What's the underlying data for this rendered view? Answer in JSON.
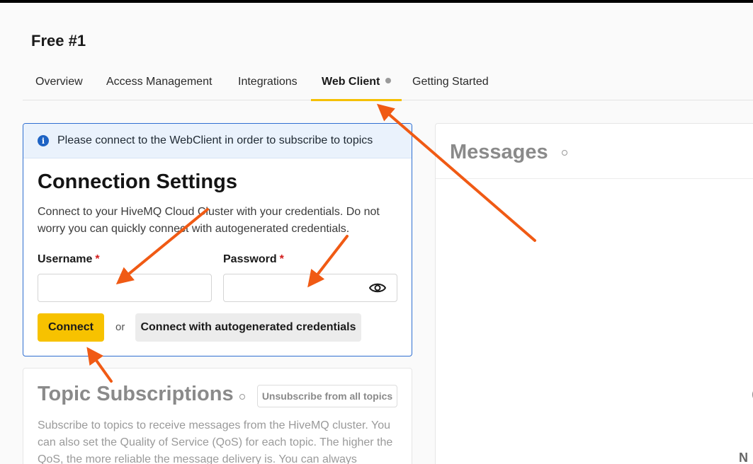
{
  "page": {
    "title": "Free #1"
  },
  "tabs": [
    {
      "label": "Overview"
    },
    {
      "label": "Access Management"
    },
    {
      "label": "Integrations"
    },
    {
      "label": "Web Client",
      "active": true
    },
    {
      "label": "Getting Started"
    }
  ],
  "connection": {
    "info_text": "Please connect to the WebClient in order to subscribe to topics",
    "title": "Connection Settings",
    "description": "Connect to your HiveMQ Cloud Cluster with your credentials. Do not worry you can quickly connect with autogenerated credentials.",
    "username_label": "Username",
    "password_label": "Password",
    "required_mark": "*",
    "username_value": "",
    "password_value": "",
    "connect_label": "Connect",
    "or_text": "or",
    "autogen_label": "Connect with autogenerated credentials"
  },
  "topics": {
    "title": "Topic Subscriptions",
    "unsubscribe_label": "Unsubscribe from all topics",
    "description": "Subscribe to topics to receive messages from the HiveMQ cluster. You can also set the Quality of Service (QoS) for each topic. The higher the QoS, the more reliable the message delivery is. You can always"
  },
  "messages": {
    "title": "Messages",
    "truncated_text": "N",
    "truncated_text_2": "("
  },
  "icons": {
    "info": "info-icon",
    "eye": "eye-icon",
    "tab_indicator": "dot-icon"
  },
  "colors": {
    "accent": "#f7c200",
    "info_blue": "#1e63c4",
    "arrow": "#f05a14",
    "required": "#d21c1c"
  }
}
